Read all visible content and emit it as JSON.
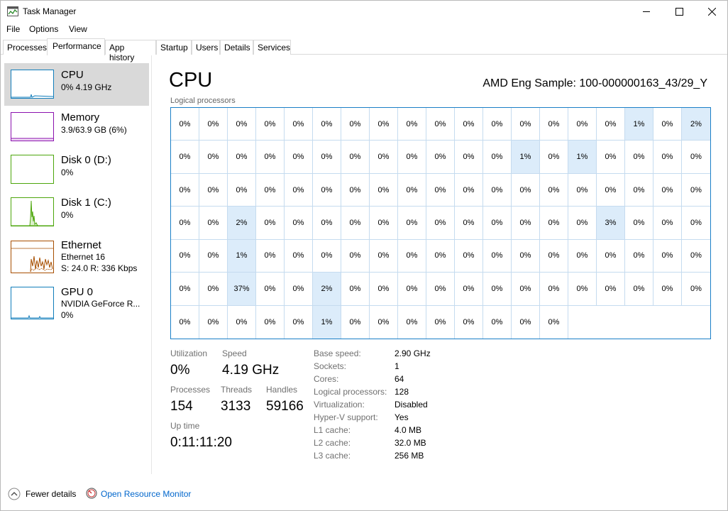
{
  "window": {
    "title": "Task Manager"
  },
  "menu": [
    "File",
    "Options",
    "View"
  ],
  "tabs": [
    "Processes",
    "Performance",
    "App history",
    "Startup",
    "Users",
    "Details",
    "Services"
  ],
  "active_tab": "Performance",
  "sidebar": [
    {
      "title": "CPU",
      "sub": "0% 4.19 GHz",
      "color": "#117dbb",
      "icon": "cpu-graph-icon"
    },
    {
      "title": "Memory",
      "sub": "3.9/63.9 GB (6%)",
      "color": "#8b12ae",
      "icon": "memory-graph-icon"
    },
    {
      "title": "Disk 0 (D:)",
      "sub": "0%",
      "color": "#4da60c",
      "icon": "disk-graph-icon"
    },
    {
      "title": "Disk 1 (C:)",
      "sub": "0%",
      "color": "#4da60c",
      "icon": "disk-graph-icon"
    },
    {
      "title": "Ethernet",
      "sub": "Ethernet 16",
      "sub2": "S: 24.0  R: 336 Kbps",
      "color": "#a74f01",
      "icon": "network-graph-icon"
    },
    {
      "title": "GPU 0",
      "sub": "NVIDIA GeForce R...",
      "sub2": "0%",
      "color": "#117dbb",
      "icon": "gpu-graph-icon"
    }
  ],
  "main": {
    "title": "CPU",
    "model": "AMD Eng Sample: 100-000000163_43/29_Y",
    "grid_label": "Logical processors",
    "accent": "#1a7fc7",
    "cells": [
      "0%",
      "0%",
      "0%",
      "0%",
      "0%",
      "0%",
      "0%",
      "0%",
      "0%",
      "0%",
      "0%",
      "0%",
      "0%",
      "0%",
      "0%",
      "0%",
      "1%",
      "0%",
      "2%",
      "0%",
      "0%",
      "0%",
      "0%",
      "0%",
      "0%",
      "0%",
      "0%",
      "0%",
      "0%",
      "0%",
      "0%",
      "1%",
      "0%",
      "1%",
      "0%",
      "0%",
      "0%",
      "0%",
      "0%",
      "0%",
      "0%",
      "0%",
      "0%",
      "0%",
      "0%",
      "0%",
      "0%",
      "0%",
      "0%",
      "0%",
      "0%",
      "0%",
      "0%",
      "0%",
      "0%",
      "0%",
      "0%",
      "0%",
      "0%",
      "2%",
      "0%",
      "0%",
      "0%",
      "0%",
      "0%",
      "0%",
      "0%",
      "0%",
      "0%",
      "0%",
      "0%",
      "0%",
      "3%",
      "0%",
      "0%",
      "0%",
      "0%",
      "0%",
      "1%",
      "0%",
      "0%",
      "0%",
      "0%",
      "0%",
      "0%",
      "0%",
      "0%",
      "0%",
      "0%",
      "0%",
      "0%",
      "0%",
      "0%",
      "0%",
      "0%",
      "0%",
      "0%",
      "37%",
      "0%",
      "0%",
      "2%",
      "0%",
      "0%",
      "0%",
      "0%",
      "0%",
      "0%",
      "0%",
      "0%",
      "0%",
      "0%",
      "0%",
      "0%",
      "0%",
      "0%",
      "0%",
      "0%",
      "0%",
      "0%",
      "1%",
      "0%",
      "0%",
      "0%",
      "0%",
      "0%",
      "0%",
      "0%",
      "0%"
    ],
    "stats": {
      "utilization_label": "Utilization",
      "utilization": "0%",
      "speed_label": "Speed",
      "speed": "4.19 GHz",
      "processes_label": "Processes",
      "processes": "154",
      "threads_label": "Threads",
      "threads": "3133",
      "handles_label": "Handles",
      "handles": "59166",
      "uptime_label": "Up time",
      "uptime": "0:11:11:20"
    },
    "info": [
      {
        "label": "Base speed:",
        "value": "2.90 GHz"
      },
      {
        "label": "Sockets:",
        "value": "1"
      },
      {
        "label": "Cores:",
        "value": "64"
      },
      {
        "label": "Logical processors:",
        "value": "128"
      },
      {
        "label": "Virtualization:",
        "value": "Disabled"
      },
      {
        "label": "Hyper-V support:",
        "value": "Yes"
      },
      {
        "label": "L1 cache:",
        "value": "4.0 MB"
      },
      {
        "label": "L2 cache:",
        "value": "32.0 MB"
      },
      {
        "label": "L3 cache:",
        "value": "256 MB"
      }
    ]
  },
  "footer": {
    "fewer_details": "Fewer details",
    "resource_monitor": "Open Resource Monitor"
  }
}
